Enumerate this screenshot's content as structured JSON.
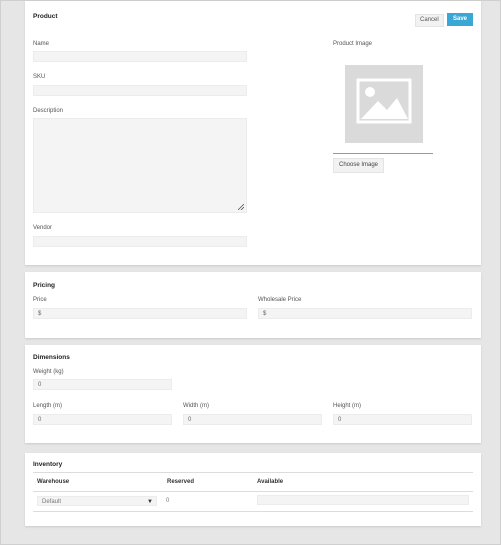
{
  "product": {
    "title": "Product",
    "cancel_label": "Cancel",
    "save_label": "Save",
    "name_label": "Name",
    "name_value": "",
    "sku_label": "SKU",
    "sku_value": "",
    "description_label": "Description",
    "description_value": "",
    "vendor_label": "Vendor",
    "vendor_value": "",
    "image_label": "Product Image",
    "choose_image_label": "Choose Image",
    "image_icon": "image-placeholder-icon"
  },
  "pricing": {
    "title": "Pricing",
    "price_label": "Price",
    "price_prefix": "$",
    "wholesale_label": "Wholesale Price",
    "wholesale_prefix": "$"
  },
  "dimensions": {
    "title": "Dimensions",
    "weight_label": "Weight (kg)",
    "weight_value": "0",
    "length_label": "Length (m)",
    "length_value": "0",
    "width_label": "Width (m)",
    "width_value": "0",
    "height_label": "Height (m)",
    "height_value": "0"
  },
  "inventory": {
    "title": "Inventory",
    "columns": [
      "Warehouse",
      "Reserved",
      "Available"
    ],
    "rows": [
      {
        "warehouse": "Default",
        "reserved": "0",
        "available": ""
      }
    ]
  },
  "colors": {
    "accent": "#39a8d6",
    "background": "#e6e6e6",
    "card": "#ffffff",
    "field": "#f4f4f4"
  }
}
